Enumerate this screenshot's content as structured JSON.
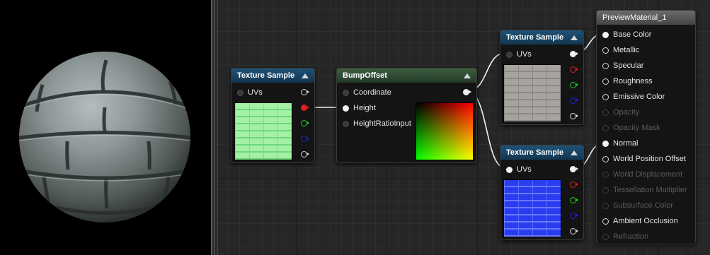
{
  "colors": {
    "graph_bg": "#262626",
    "texture_header": "#1f5277",
    "bump_header": "#3d5f3d",
    "material_header": "#6b6b6b",
    "wire": "#f2f2f2",
    "pin_red": "#e02020",
    "pin_green": "#20d020",
    "pin_blue": "#2020e0"
  },
  "icons": {
    "collapse": "triangle-up-icon",
    "output_pin": "exec-ring-icon"
  },
  "preview": {
    "shape": "sphere",
    "material": "stone-brick"
  },
  "nodes": {
    "texture_sample_1": {
      "title": "Texture Sample",
      "inputs": [
        "UVs"
      ],
      "thumbnail": "green-brick-normal"
    },
    "bump_offset": {
      "title": "BumpOffset",
      "inputs": [
        "Coordinate",
        "Height",
        "HeightRatioInput"
      ],
      "thumbnail": "uv-gradient"
    },
    "texture_sample_2": {
      "title": "Texture Sample",
      "inputs": [
        "UVs"
      ],
      "thumbnail": "grey-brick-diffuse"
    },
    "texture_sample_3": {
      "title": "Texture Sample",
      "inputs": [
        "UVs"
      ],
      "thumbnail": "blue-brick-normal"
    },
    "preview_material": {
      "title": "PreviewMaterial_1",
      "inputs": [
        {
          "label": "Base Color",
          "enabled": true,
          "connected": true
        },
        {
          "label": "Metallic",
          "enabled": true,
          "connected": false
        },
        {
          "label": "Specular",
          "enabled": true,
          "connected": false
        },
        {
          "label": "Roughness",
          "enabled": true,
          "connected": false
        },
        {
          "label": "Emissive Color",
          "enabled": true,
          "connected": false
        },
        {
          "label": "Opacity",
          "enabled": false,
          "connected": false
        },
        {
          "label": "Opacity Mask",
          "enabled": false,
          "connected": false
        },
        {
          "label": "Normal",
          "enabled": true,
          "connected": true
        },
        {
          "label": "World Position Offset",
          "enabled": true,
          "connected": false
        },
        {
          "label": "World Displacement",
          "enabled": false,
          "connected": false
        },
        {
          "label": "Tessellation Multiplier",
          "enabled": false,
          "connected": false
        },
        {
          "label": "Subsurface Color",
          "enabled": false,
          "connected": false
        },
        {
          "label": "Ambient Occlusion",
          "enabled": true,
          "connected": false
        },
        {
          "label": "Refraction",
          "enabled": false,
          "connected": false
        }
      ]
    }
  }
}
